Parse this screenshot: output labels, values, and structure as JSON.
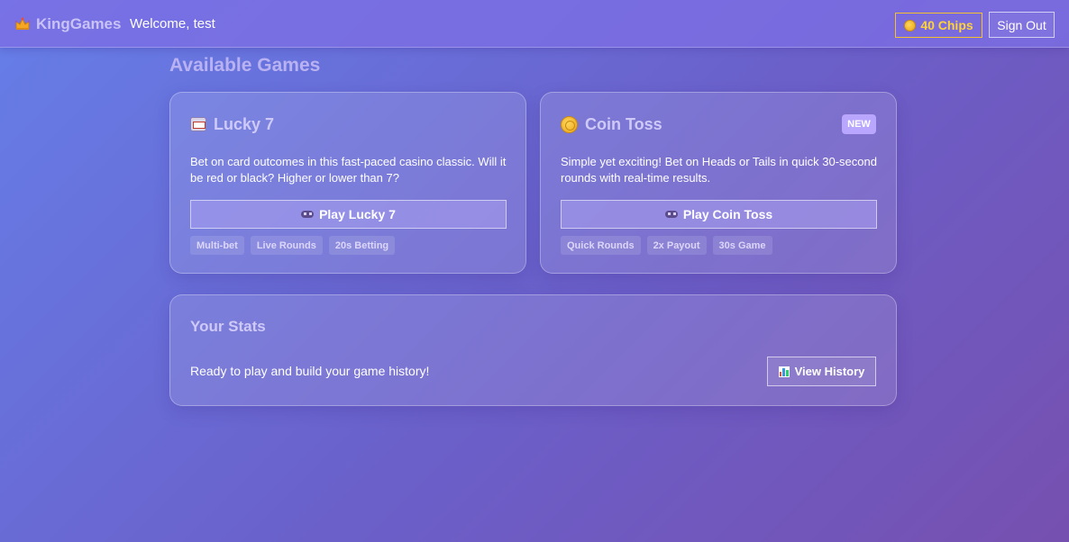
{
  "header": {
    "brand": "KingGames",
    "welcome": "Welcome, test",
    "chips_label": "40 Chips",
    "signout_label": "Sign Out"
  },
  "section_title": "Available Games",
  "games": [
    {
      "title": "Lucky 7",
      "icon": "slot-machine-icon",
      "description": "Bet on card outcomes in this fast-paced casino classic. Will it be red or black? Higher or lower than 7?",
      "play_label": "Play Lucky 7",
      "tags": [
        "Multi-bet",
        "Live Rounds",
        "20s Betting"
      ]
    },
    {
      "title": "Coin Toss",
      "icon": "coin-icon",
      "badge": "NEW",
      "description": "Simple yet exciting! Bet on Heads or Tails in quick 30-second rounds with real-time results.",
      "play_label": "Play Coin Toss",
      "tags": [
        "Quick Rounds",
        "2x Payout",
        "30s Game"
      ]
    }
  ],
  "stats": {
    "title": "Your Stats",
    "text": "Ready to play and build your game history!",
    "history_label": "View History"
  },
  "colors": {
    "accent": "#7c6ee4",
    "chips": "#ffd23a",
    "badge": "#b8a6ff"
  }
}
